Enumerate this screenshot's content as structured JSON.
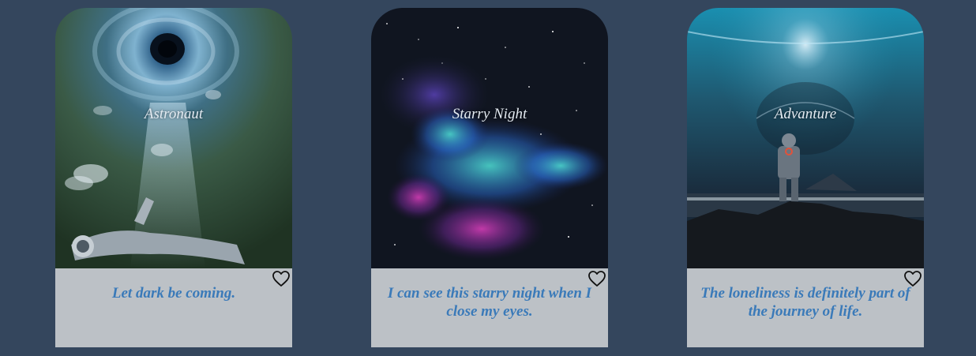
{
  "cards": [
    {
      "title": "Astronaut",
      "quote": "Let dark be coming.",
      "heart_icon": "heart-outline-icon"
    },
    {
      "title": "Starry Night",
      "quote": "I can see this starry night when I close my eyes.",
      "heart_icon": "heart-outline-icon"
    },
    {
      "title": "Advanture",
      "quote": "The loneliness is definitely part of the journey of life.",
      "heart_icon": "heart-outline-icon"
    }
  ],
  "colors": {
    "background": "#34465d",
    "card_body": "#bcc1c6",
    "quote_text": "#3a7ab9",
    "title_text": "#e4ebf2"
  }
}
